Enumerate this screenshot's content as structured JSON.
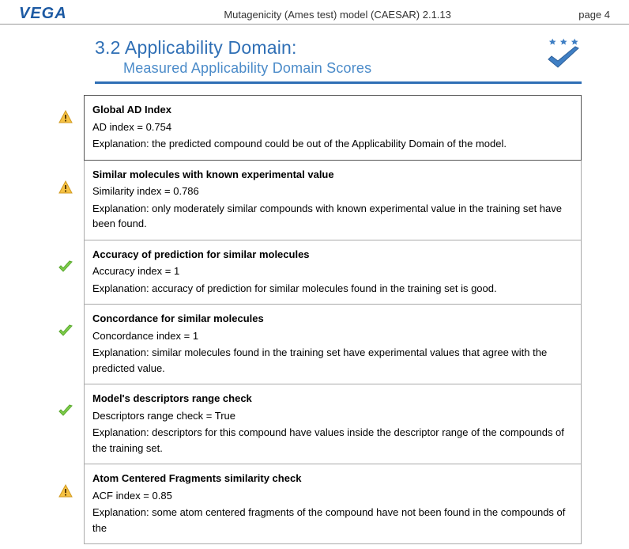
{
  "header": {
    "logo_text": "VEGA",
    "title": "Mutagenicity (Ames test) model (CAESAR) 2.1.13",
    "page_label": "page 4"
  },
  "section": {
    "number": "3.2",
    "title": "Applicability Domain:",
    "subtitle": "Measured Applicability Domain Scores",
    "stars": 3
  },
  "items": [
    {
      "status": "warn",
      "title": "Global AD Index",
      "value": "AD index = 0.754",
      "explanation": "Explanation: the predicted compound could be out of the Applicability Domain of the model."
    },
    {
      "status": "warn",
      "title": "Similar molecules with known experimental value",
      "value": "Similarity index = 0.786",
      "explanation": "Explanation: only moderately similar compounds with known experimental value in the training set have been found."
    },
    {
      "status": "ok",
      "title": "Accuracy of prediction for similar molecules",
      "value": "Accuracy index = 1",
      "explanation": "Explanation: accuracy of prediction for similar molecules found in the training set is good."
    },
    {
      "status": "ok",
      "title": "Concordance for similar molecules",
      "value": "Concordance index = 1",
      "explanation": "Explanation: similar molecules found in the training set have experimental values that agree with the predicted value."
    },
    {
      "status": "ok",
      "title": "Model's descriptors range check",
      "value": "Descriptors range check = True",
      "explanation": "Explanation: descriptors for this compound have values inside the descriptor range of the compounds of the training set."
    },
    {
      "status": "warn",
      "title": "Atom Centered Fragments similarity check",
      "value": "ACF index = 0.85",
      "explanation": "Explanation: some atom centered fragments of the compound have not been found in the compounds of the"
    }
  ]
}
